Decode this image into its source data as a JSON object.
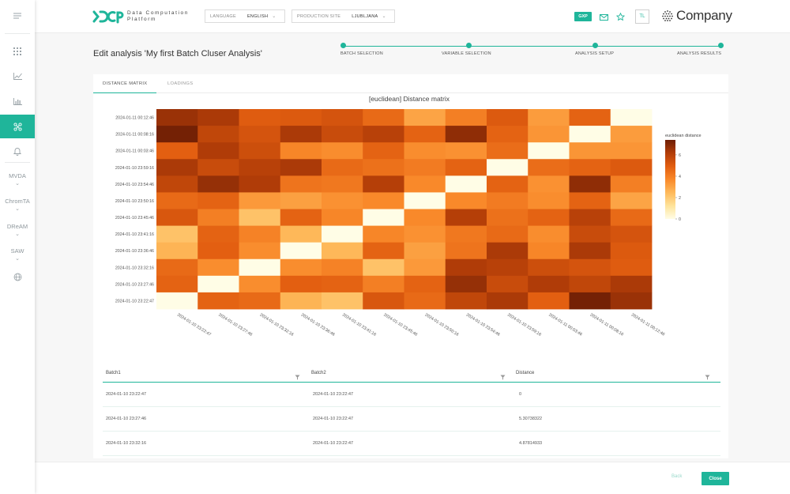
{
  "sidebar": {
    "items": [
      {
        "icon": "menu-icon"
      },
      {
        "icon": "grid-icon"
      },
      {
        "icon": "line-chart-icon"
      },
      {
        "icon": "bar-chart-icon"
      },
      {
        "icon": "cluster-icon",
        "active": true
      },
      {
        "icon": "bell-icon"
      }
    ],
    "sections": [
      "MVDA",
      "ChromTA",
      "DReAM",
      "SAW"
    ],
    "globe_icon": "globe-icon"
  },
  "header": {
    "logo_line1": "Data Computation",
    "logo_line2": "Platform",
    "language_label": "LANGUAGE",
    "language_value": "ENGLISH",
    "site_label": "PRODUCTION SITE",
    "site_value": "LJUBLJANA",
    "gxp_badge": "GXP",
    "user_initials": "TL",
    "company_name": "Company"
  },
  "page": {
    "title": "Edit analysis 'My first Batch Cluser Analysis'"
  },
  "stepper": {
    "steps": [
      "BATCH SELECTION",
      "VARIABLE SELECTION",
      "ANALYSIS SETUP",
      "ANALYSIS RESULTS"
    ]
  },
  "tabs": [
    "DISTANCE MATRIX",
    "LOADINGS"
  ],
  "chart_data": {
    "type": "heatmap",
    "title": "[euclidean] Distance matrix",
    "colorbar_label": "euclidean distance",
    "colorbar_ticks": [
      0,
      2,
      4,
      6
    ],
    "zlim": [
      0,
      7.4
    ],
    "colorscale": [
      "#fffde6",
      "#fee39a",
      "#feb95a",
      "#f9892a",
      "#e25e10",
      "#b23d08",
      "#6e1e05"
    ],
    "x_labels": [
      "2024-01-10 23:22:47",
      "2024-01-10 23:27:46",
      "2024-01-10 23:32:16",
      "2024-01-10 23:36:46",
      "2024-01-10 23:41:16",
      "2024-01-10 23:45:46",
      "2024-01-10 23:50:16",
      "2024-01-10 23:54:46",
      "2024-01-10 23:59:16",
      "2024-01-11 00:03:46",
      "2024-01-11 00:08:16",
      "2024-01-11 00:12:46"
    ],
    "y_labels": [
      "2024-01-11 00:12:46",
      "2024-01-11 00:08:16",
      "2024-01-11 00:03:46",
      "2024-01-10 23:59:16",
      "2024-01-10 23:54:46",
      "2024-01-10 23:50:16",
      "2024-01-10 23:45:46",
      "2024-01-10 23:41:16",
      "2024-01-10 23:36:46",
      "2024-01-10 23:32:16",
      "2024-01-10 23:27:46",
      "2024-01-10 23:22:47"
    ],
    "z": [
      [
        6.6,
        6.3,
        5.0,
        5.1,
        5.3,
        4.6,
        3.0,
        4.0,
        5.1,
        3.2,
        4.8,
        0
      ],
      [
        7.3,
        5.8,
        5.3,
        6.3,
        5.6,
        6.0,
        4.8,
        6.8,
        4.8,
        3.4,
        0,
        3.2
      ],
      [
        4.9,
        6.2,
        5.5,
        3.8,
        3.6,
        4.8,
        3.6,
        3.5,
        4.5,
        0,
        3.4,
        3.4
      ],
      [
        6.3,
        5.6,
        6.0,
        6.3,
        4.6,
        4.4,
        4.1,
        4.8,
        0,
        4.5,
        4.8,
        5.1
      ],
      [
        5.8,
        6.7,
        6.2,
        4.3,
        4.2,
        6.1,
        3.7,
        0,
        4.8,
        3.5,
        6.8,
        4.0
      ],
      [
        4.6,
        4.8,
        3.3,
        3.1,
        3.5,
        3.7,
        0,
        3.7,
        4.1,
        3.6,
        4.8,
        3.0
      ],
      [
        5.2,
        4.0,
        2.2,
        4.8,
        3.8,
        0,
        3.7,
        6.1,
        4.4,
        4.8,
        6.0,
        4.6
      ],
      [
        2.2,
        4.8,
        3.9,
        2.5,
        0,
        3.8,
        3.5,
        4.2,
        4.6,
        3.6,
        5.6,
        5.3
      ],
      [
        2.6,
        4.9,
        3.6,
        0,
        2.5,
        4.8,
        3.1,
        4.3,
        6.3,
        3.8,
        6.3,
        5.1
      ],
      [
        4.6,
        3.6,
        0,
        3.6,
        3.9,
        2.2,
        3.3,
        6.2,
        6.0,
        5.5,
        5.3,
        5.0
      ],
      [
        4.8,
        0,
        3.6,
        4.9,
        4.8,
        4.0,
        4.8,
        6.7,
        5.6,
        6.2,
        5.8,
        6.3
      ],
      [
        0,
        4.8,
        4.6,
        2.6,
        2.2,
        5.2,
        4.6,
        5.8,
        6.3,
        4.9,
        7.3,
        6.6
      ]
    ]
  },
  "table": {
    "columns": [
      "Batch1",
      "Batch2",
      "Distance"
    ],
    "rows": [
      [
        "2024-01-10 23:22:47",
        "2024-01-10 23:22:47",
        "0"
      ],
      [
        "2024-01-10 23:27:46",
        "2024-01-10 23:22:47",
        "5.30738322"
      ],
      [
        "2024-01-10 23:32:16",
        "2024-01-10 23:22:47",
        "4.87814933"
      ]
    ]
  },
  "footer": {
    "back_label": "Back",
    "close_label": "Close"
  },
  "colors": {
    "accent": "#1fb59a"
  }
}
